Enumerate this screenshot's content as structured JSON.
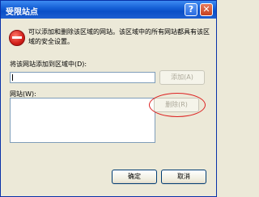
{
  "dialog": {
    "title": "受限站点",
    "help_icon": "help-icon",
    "close_icon": "close-icon"
  },
  "message": {
    "icon": "stop-icon",
    "text": "可以添加和删除该区域的网站。该区域中的所有网站都具有该区域的安全设置。"
  },
  "add_site": {
    "label": "将该网站添加到区域中(D):",
    "input_value": "",
    "add_button": "添加(A)"
  },
  "sites": {
    "label": "网站(W):",
    "items": [],
    "remove_button": "删除(R)"
  },
  "footer": {
    "ok_button": "确定",
    "cancel_button": "取消"
  }
}
